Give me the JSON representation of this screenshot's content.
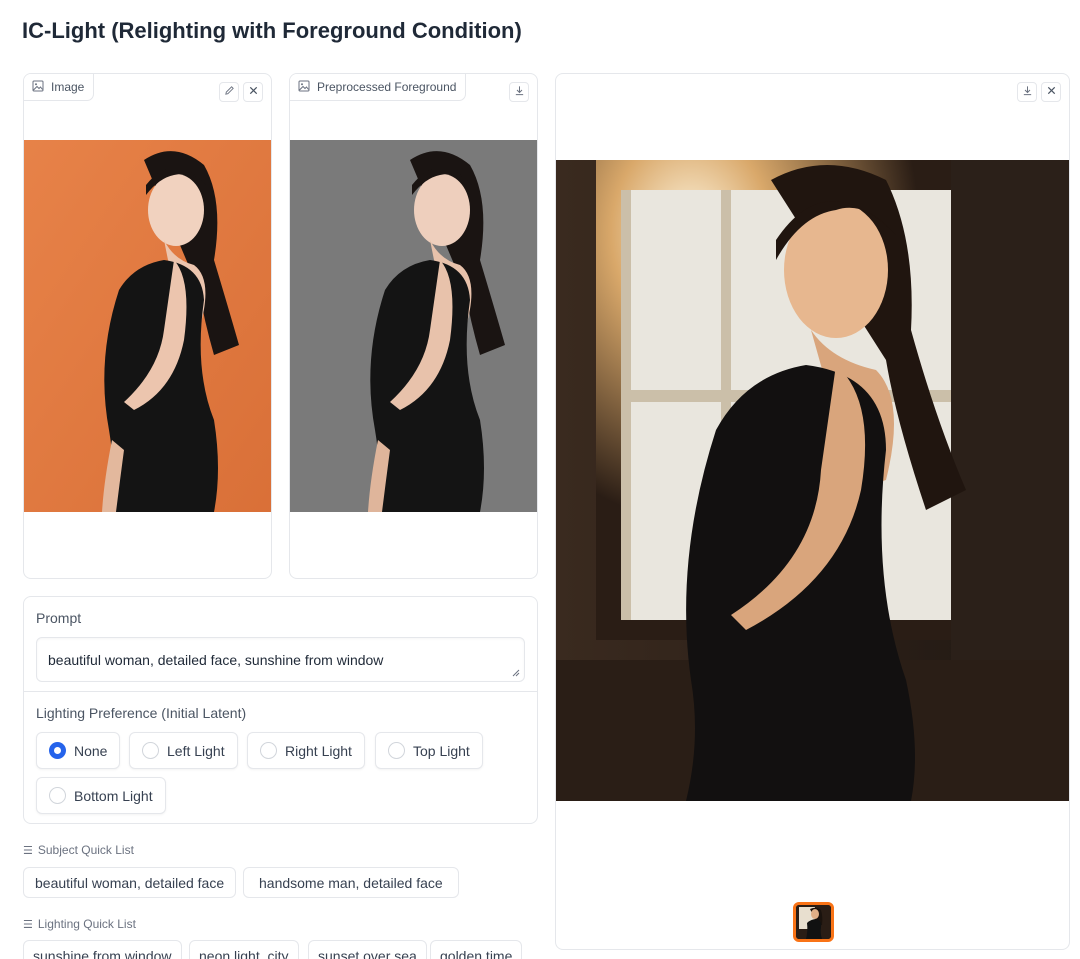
{
  "page": {
    "title": "IC-Light (Relighting with Foreground Condition)"
  },
  "input_image": {
    "label": "Image",
    "icon": "image-icon",
    "buttons": [
      "edit-icon",
      "close-icon"
    ]
  },
  "preprocessed": {
    "label": "Preprocessed Foreground",
    "icon": "image-icon",
    "buttons": [
      "download-icon"
    ]
  },
  "output_gallery": {
    "buttons": [
      "download-icon",
      "close-icon"
    ]
  },
  "prompt": {
    "label": "Prompt",
    "value": "beautiful woman, detailed face, sunshine from window"
  },
  "lighting": {
    "label": "Lighting Preference (Initial Latent)",
    "options": [
      "None",
      "Left Light",
      "Right Light",
      "Top Light",
      "Bottom Light"
    ],
    "selected": "None"
  },
  "subject_quick_list": {
    "label": "Subject Quick List",
    "items": [
      "beautiful woman, detailed face",
      "handsome man, detailed face"
    ]
  },
  "lighting_quick_list": {
    "label": "Lighting Quick List",
    "items": [
      "sunshine from window",
      "neon light, city",
      "sunset over sea",
      "golden time"
    ]
  },
  "colors": {
    "accent": "#2563eb",
    "thumb_border": "#f97316",
    "orange_bg": "#e2793f",
    "grey_bg": "#7a7a7a"
  }
}
